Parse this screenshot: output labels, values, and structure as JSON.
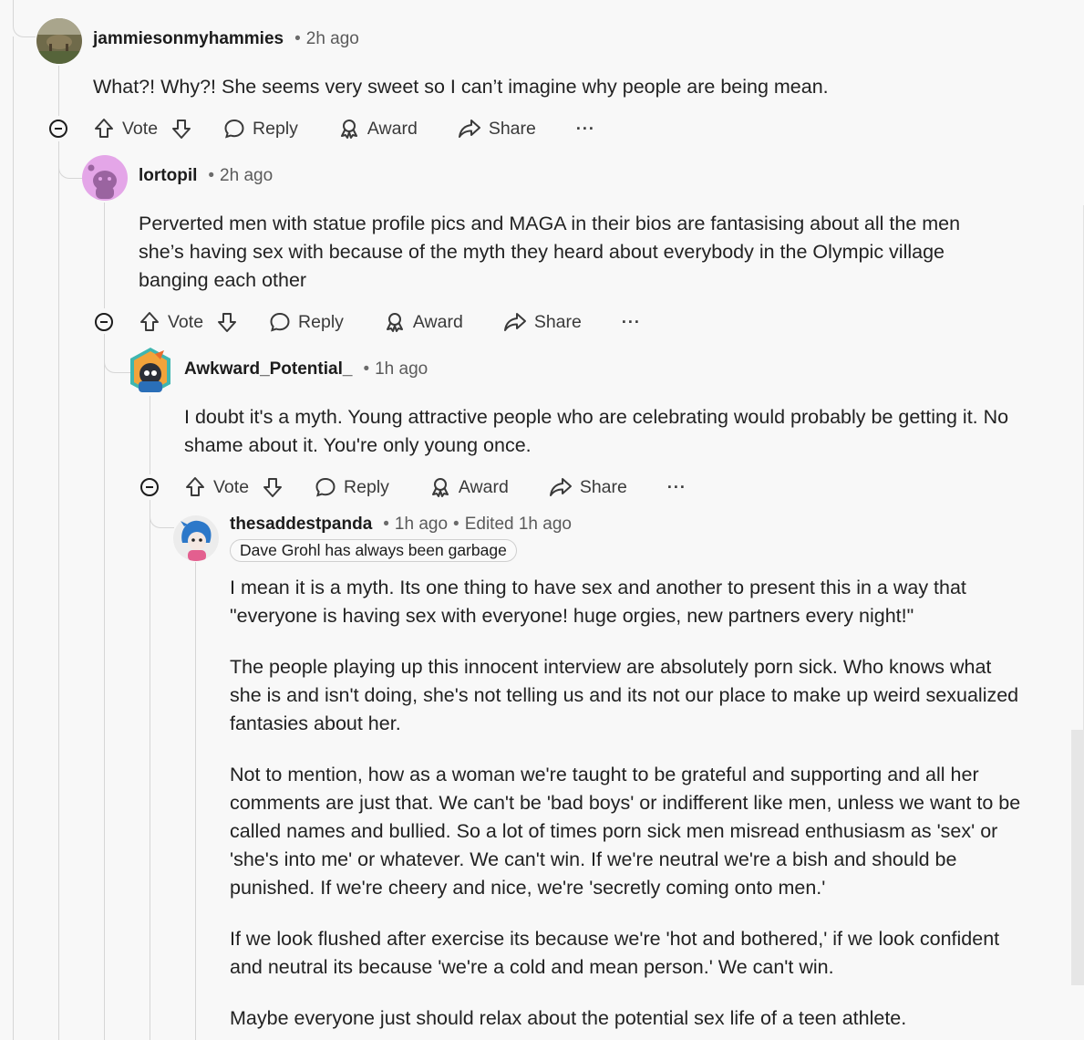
{
  "comments": [
    {
      "username": "jammiesonmyhammies",
      "time": "2h ago",
      "body": [
        "What?! Why?! She seems very sweet so I can’t imagine why people are being mean."
      ]
    },
    {
      "username": "lortopil",
      "time": "2h ago",
      "body": [
        "Perverted men with statue profile pics and MAGA in their bios are fantasising about all the men she’s having sex with because of the myth they heard about everybody in the Olympic village banging each other"
      ]
    },
    {
      "username": "Awkward_Potential_",
      "time": "1h ago",
      "body": [
        "I doubt it's a myth. Young attractive people who are celebrating would probably be getting it. No shame about it. You're only young once."
      ]
    },
    {
      "username": "thesaddestpanda",
      "time": "1h ago",
      "edited": "Edited 1h ago",
      "flair": "Dave Grohl has always been garbage",
      "body": [
        "I mean it is a myth. Its one thing to have sex and another to present this in a way that \"everyone is having sex with everyone! huge orgies, new partners every night!\"",
        "The people playing up this innocent interview are absolutely porn sick. Who knows what she is and isn't doing, she's not telling us and its not our place to make up weird sexualized fantasies about her.",
        "Not to mention, how as a woman we're taught to be grateful and supporting and all her comments are just that. We can't be 'bad boys' or indifferent like men, unless we want to be called names and bullied. So a lot of times porn sick men misread enthusiasm as 'sex' or 'she's into me' or whatever. We can't win. If we're neutral we're a bish and should be punished. If we're cheery and nice, we're 'secretly coming onto men.'",
        "If we look flushed after exercise its because we're 'hot and bothered,' if we look confident and neutral its because 'we're a cold and mean person.' We can't win.",
        "Maybe everyone just should relax about the potential sex life of a teen athlete."
      ]
    }
  ],
  "actions": {
    "vote": "Vote",
    "reply": "Reply",
    "award": "Award",
    "share": "Share",
    "more": "···"
  },
  "separator": "•",
  "icons": [
    "upvote-icon",
    "downvote-icon",
    "reply-icon",
    "award-icon",
    "share-icon",
    "collapse-icon",
    "more-icon"
  ]
}
